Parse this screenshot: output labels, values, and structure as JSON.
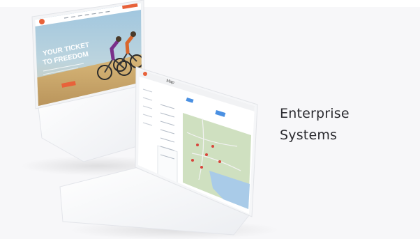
{
  "headline": {
    "line1": "Enterprise",
    "line2": "Systems"
  },
  "laptop_front_screen": {
    "hero_line1": "YOUR TICKET",
    "hero_line2": "TO FREEDOM"
  },
  "laptop_back_screen": {
    "map_title": "Map"
  },
  "colors": {
    "background": "#f7f7f9",
    "headline_text": "#2a2a2f",
    "accent_orange": "#e8623a",
    "map_accent_blue": "#4a90e2",
    "map_land": "#cfe0c0",
    "map_water": "#a9cbe8"
  },
  "icons": [
    "logo-badge-icon",
    "map-pin-icon"
  ]
}
